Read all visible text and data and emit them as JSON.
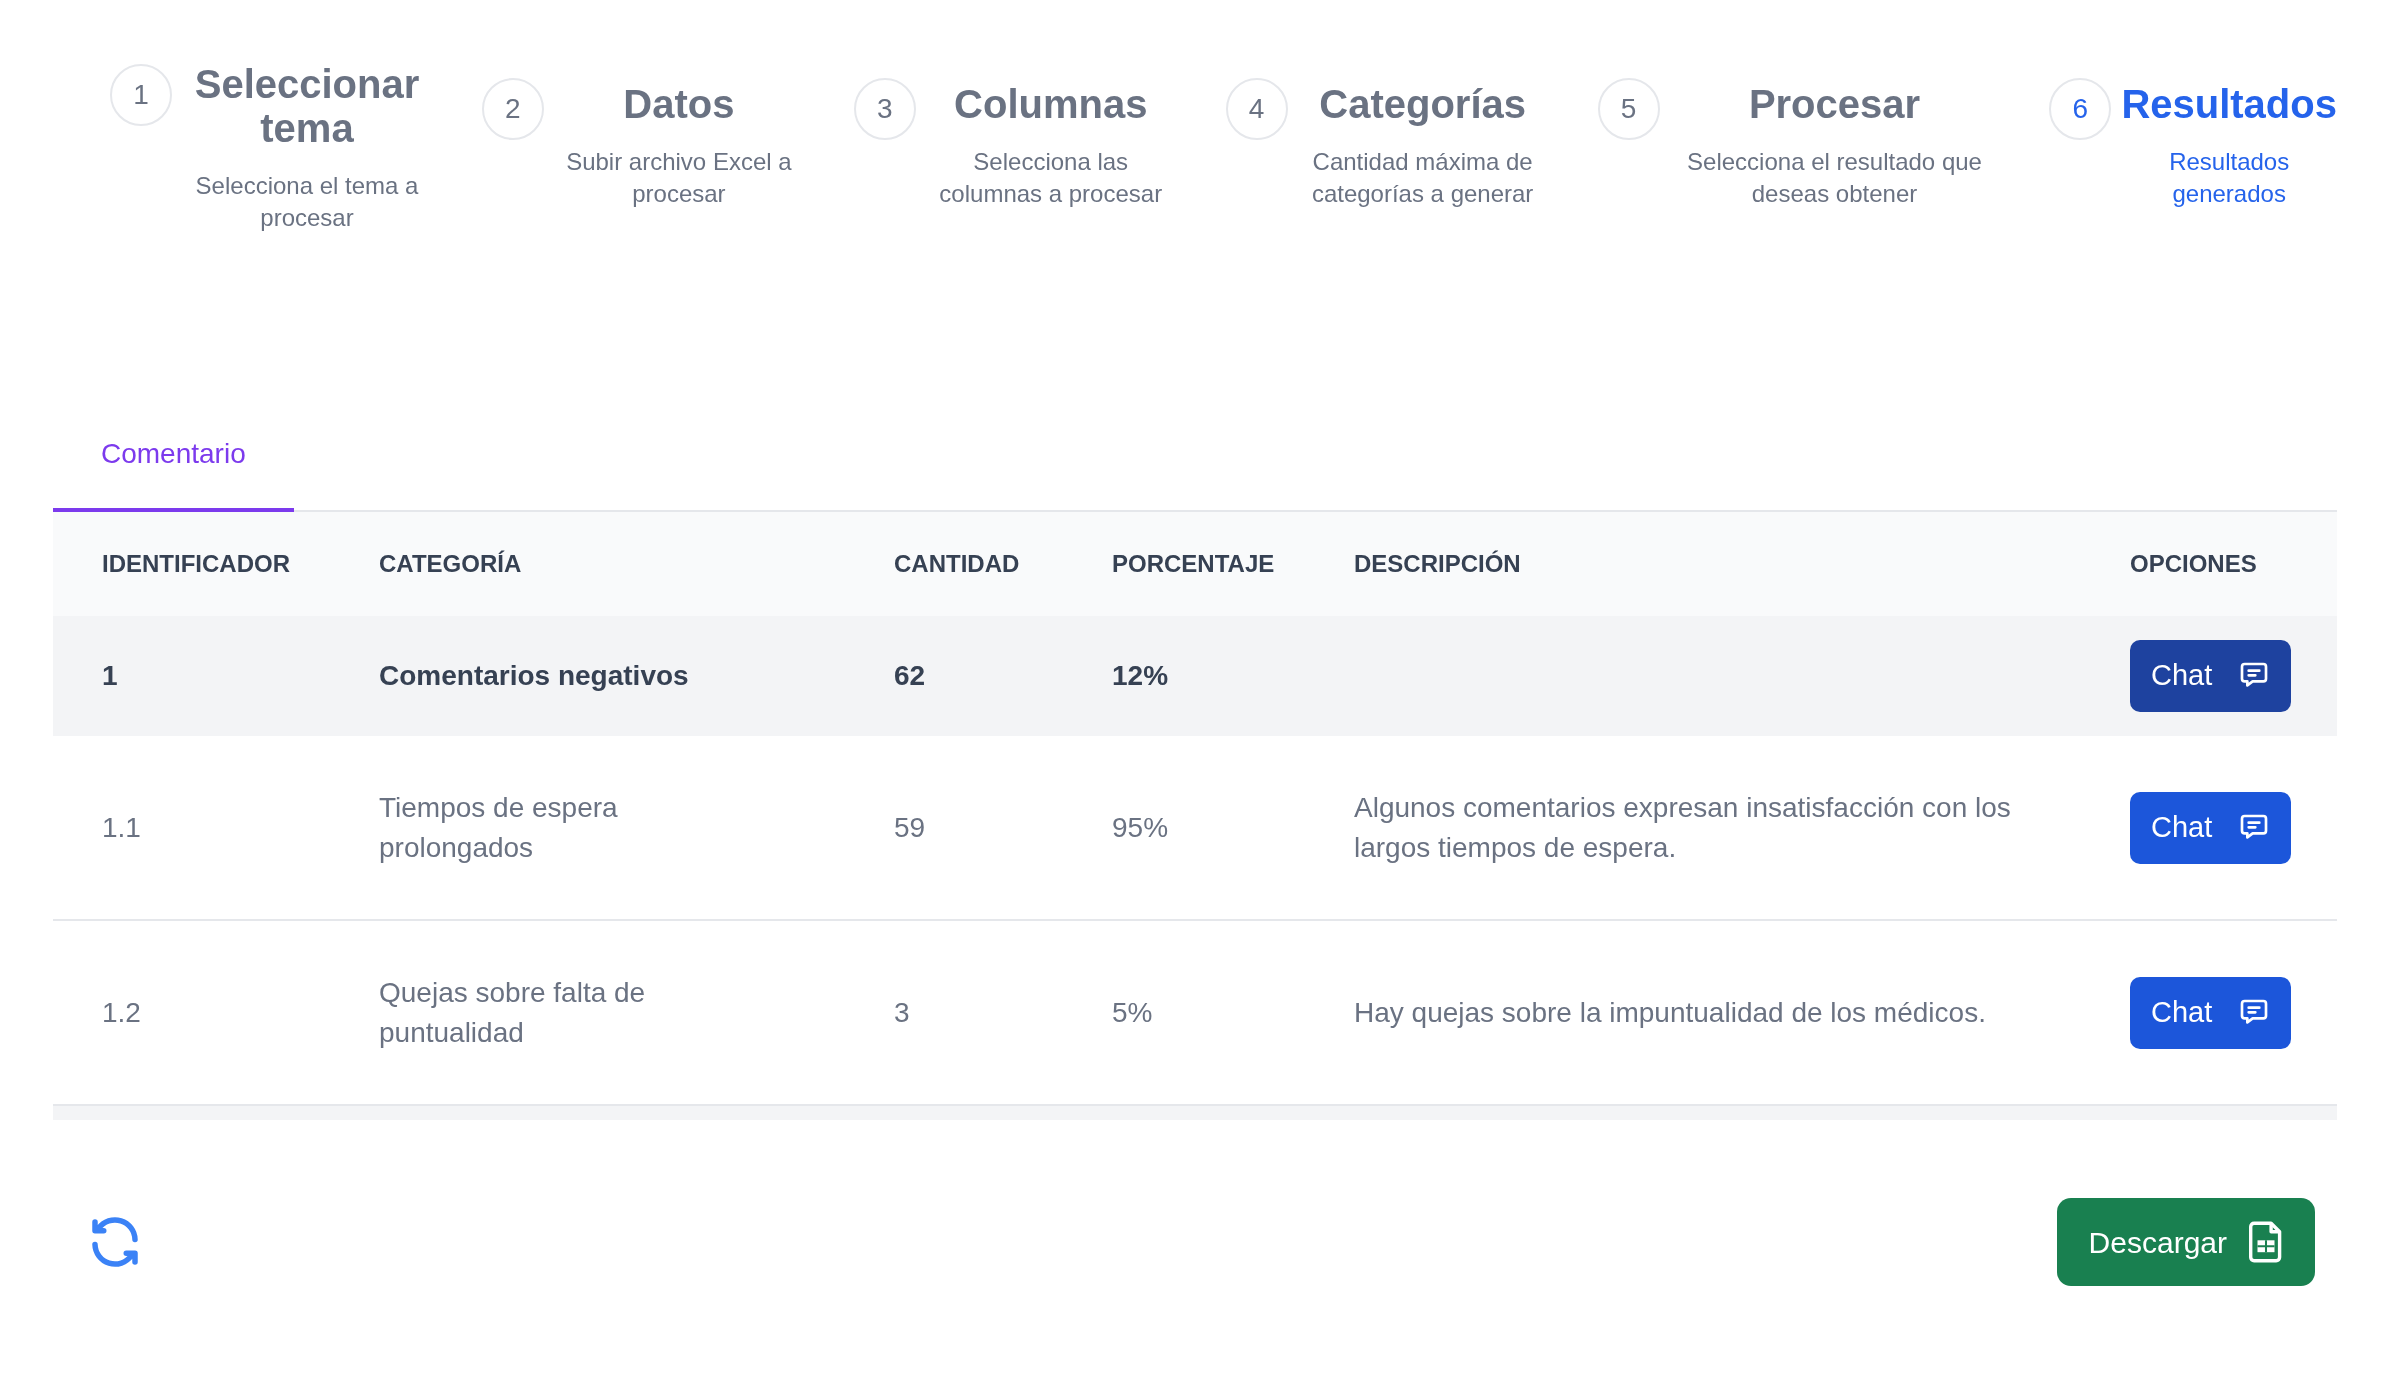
{
  "steps": [
    {
      "number": "1",
      "title": "Seleccionar tema",
      "subtitle": "Selecciona el tema a procesar",
      "selected": false
    },
    {
      "number": "2",
      "title": "Datos",
      "subtitle": "Subir archivo Excel a procesar",
      "selected": false
    },
    {
      "number": "3",
      "title": "Columnas",
      "subtitle": "Selecciona las columnas a procesar",
      "selected": false
    },
    {
      "number": "4",
      "title": "Categorías",
      "subtitle": "Cantidad máxima de categorías a generar",
      "selected": false
    },
    {
      "number": "5",
      "title": "Procesar",
      "subtitle": "Selecciona el resultado que deseas obtener",
      "selected": false
    },
    {
      "number": "6",
      "title": "Resultados",
      "subtitle": "Resultados generados",
      "selected": true
    }
  ],
  "tabs": [
    {
      "label": "Comentario",
      "selected": true
    }
  ],
  "table": {
    "columns": [
      "IDENTIFICADOR",
      "CATEGORÍA",
      "CANTIDAD",
      "PORCENTAJE",
      "DESCRIPCIÓN",
      "OPCIONES"
    ],
    "rows": [
      {
        "kind": "category",
        "id": "1",
        "category": "Comentarios negativos",
        "count": "62",
        "percent": "12%",
        "button": "Chat"
      },
      {
        "kind": "subcategory",
        "id": "1.1",
        "category": "Tiempos de espera prolongados",
        "count": "59",
        "percent": "95%",
        "description": "Algunos comentarios expresan insatisfacción con los largos tiempos de espera.",
        "button": "Chat"
      },
      {
        "kind": "subcategory",
        "id": "1.2",
        "category": "Quejas sobre falta de puntualidad",
        "count": "3",
        "percent": "5%",
        "description": "Hay quejas sobre la impuntualidad de los médicos.",
        "button": "Chat"
      }
    ]
  },
  "download_button": "Descargar"
}
